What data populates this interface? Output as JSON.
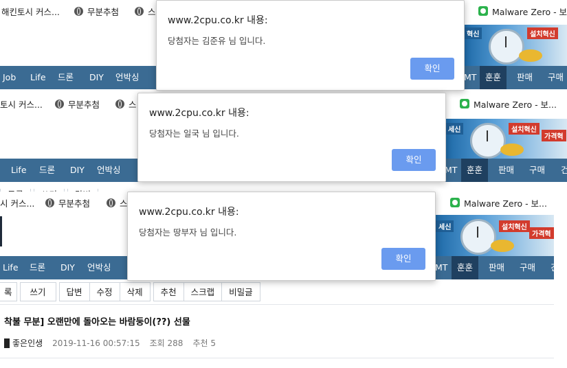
{
  "bookmarks": {
    "item1": "해킨토시 커스...",
    "item1_short": "토시 커스...",
    "item1_short2": "시 커스...",
    "item2": "무분추첨",
    "item3": "스",
    "item4": "Malware Zero - 보...",
    "item4_short": "Malware Zero - 보..."
  },
  "banner": {
    "tag1": "혁신",
    "tag1_full": "세신",
    "tag2": "설치혁신",
    "tag3": "가격혁"
  },
  "nav": {
    "items_left": [
      "Job",
      "Life",
      "드론",
      "DIY",
      "언박싱"
    ],
    "items_right": [
      "MT",
      "훈훈",
      "판매",
      "구매",
      "건"
    ]
  },
  "toolbar": {
    "partial": [
      "록",
      "쓰기",
      "답변",
      "수정",
      "삭제"
    ],
    "group2": [
      "추천",
      "스크랩",
      "비밀글"
    ],
    "peek_top": [
      "목록",
      "쓰기",
      "답변",
      "수정",
      "삭제",
      "추천",
      "스크랩",
      "비밀글"
    ]
  },
  "post": {
    "title": "착불 무분] 오랜만에 돌아오는 바람둥이(??) 선물",
    "author": "좋은인생",
    "date": "2019-11-16 00:57:15",
    "views": "조회 288",
    "likes": "추천 5"
  },
  "dialogs": [
    {
      "title": "www.2cpu.co.kr 내용:",
      "message": "당첨자는 김준유 님 입니다.",
      "ok": "확인"
    },
    {
      "title": "www.2cpu.co.kr 내용:",
      "message": "당첨자는 일국 님 입니다.",
      "ok": "확인"
    },
    {
      "title": "www.2cpu.co.kr 내용:",
      "message": "당첨자는 땅부자 님 입니다.",
      "ok": "확인"
    }
  ],
  "colors": {
    "nav": "#3b6b93",
    "nav_active": "#1f4060",
    "ok_button": "#6a9bef"
  }
}
